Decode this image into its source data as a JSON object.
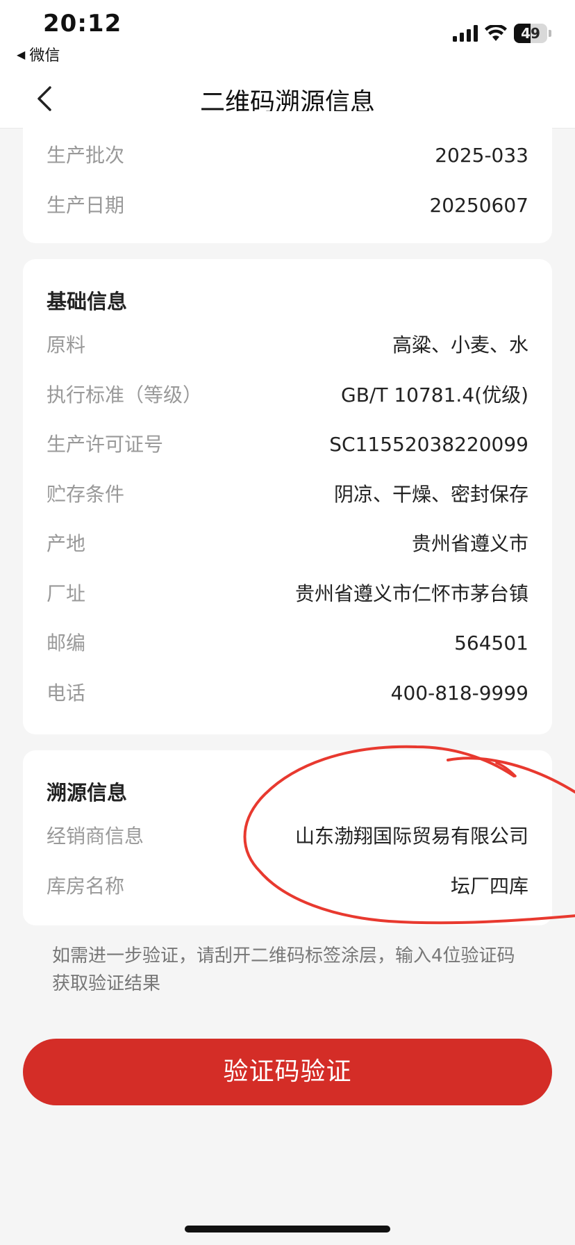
{
  "status_bar": {
    "time": "20:12",
    "back_app": "微信",
    "back_app_icon": "back-triangle-icon",
    "battery_level": "49",
    "battery_fraction": 0.49,
    "icons": [
      "cellular-signal-icon",
      "wifi-icon",
      "battery-icon"
    ]
  },
  "nav": {
    "title": "二维码溯源信息",
    "back_icon": "chevron-left-icon"
  },
  "production_card": {
    "rows": [
      {
        "label": "生产批次",
        "value": "2025-033"
      },
      {
        "label": "生产日期",
        "value": "20250607"
      }
    ]
  },
  "basic_info": {
    "title": "基础信息",
    "rows": [
      {
        "label": "原料",
        "value": "高粱、小麦、水"
      },
      {
        "label": "执行标准（等级）",
        "value": "GB/T 10781.4(优级)"
      },
      {
        "label": "生产许可证号",
        "value": "SC11552038220099"
      },
      {
        "label": "贮存条件",
        "value": "阴凉、干燥、密封保存"
      },
      {
        "label": "产地",
        "value": "贵州省遵义市"
      },
      {
        "label": "厂址",
        "value": "贵州省遵义市仁怀市茅台镇"
      },
      {
        "label": "邮编",
        "value": "564501"
      },
      {
        "label": "电话",
        "value": "400-818-9999"
      }
    ]
  },
  "trace_info": {
    "title": "溯源信息",
    "rows": [
      {
        "label": "经销商信息",
        "value": "山东渤翔国际贸易有限公司"
      },
      {
        "label": "库房名称",
        "value": "坛厂四库"
      }
    ]
  },
  "note": "如需进一步验证，请刮开二维码标签涂层，输入4位验证码获取验证结果",
  "verify_button": "验证码验证",
  "colors": {
    "primary": "#d42d27",
    "annotation": "#e8392f",
    "background": "#f5f5f5"
  }
}
